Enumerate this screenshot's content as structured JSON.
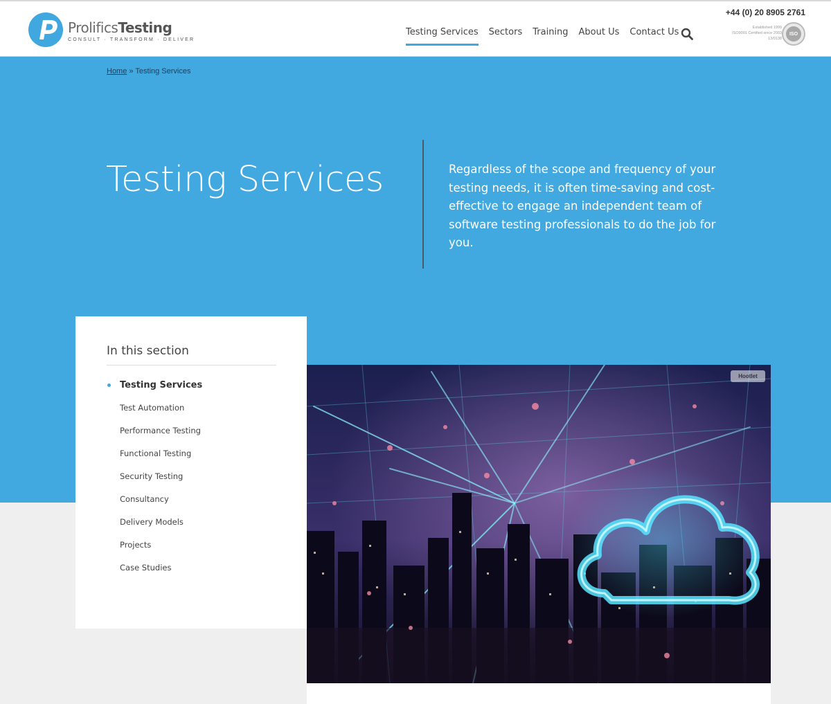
{
  "header": {
    "logo": {
      "word_light": "Prolifics",
      "word_bold": "Testing",
      "tagline": "CONSULT · TRANSFORM · DELIVER"
    },
    "phone": "+44 (0) 20 8905 2761",
    "nav": [
      {
        "label": "Testing Services",
        "active": true
      },
      {
        "label": "Sectors",
        "active": false
      },
      {
        "label": "Training",
        "active": false
      },
      {
        "label": "About Us",
        "active": false
      },
      {
        "label": "Contact Us",
        "active": false
      }
    ],
    "search_icon": "magnifier-icon",
    "iso": {
      "line1": "Established 1999",
      "line2": "ISO9001 Certified since 2003",
      "line3": "13/0138",
      "badge": "ISO"
    }
  },
  "breadcrumb": {
    "home": "Home",
    "separator": "»",
    "current": "Testing Services"
  },
  "hero": {
    "title": "Testing Services",
    "text": "Regardless of the scope and frequency of your testing needs, it is often time-saving and cost-effective to engage an independent team of software testing professionals to do the job for you."
  },
  "section_menu": {
    "heading": "In this section",
    "items": [
      {
        "label": "Testing Services",
        "current": true
      },
      {
        "label": "Test Automation",
        "current": false
      },
      {
        "label": "Performance Testing",
        "current": false
      },
      {
        "label": "Functional Testing",
        "current": false
      },
      {
        "label": "Security Testing",
        "current": false
      },
      {
        "label": "Consultancy",
        "current": false
      },
      {
        "label": "Delivery Models",
        "current": false
      },
      {
        "label": "Projects",
        "current": false
      },
      {
        "label": "Case Studies",
        "current": false
      }
    ]
  },
  "image": {
    "badge": "Hootlet"
  },
  "colors": {
    "accent": "#41a8df",
    "hero_bg": "#41a8e0",
    "page_bg": "#efefef",
    "text": "#444444"
  }
}
